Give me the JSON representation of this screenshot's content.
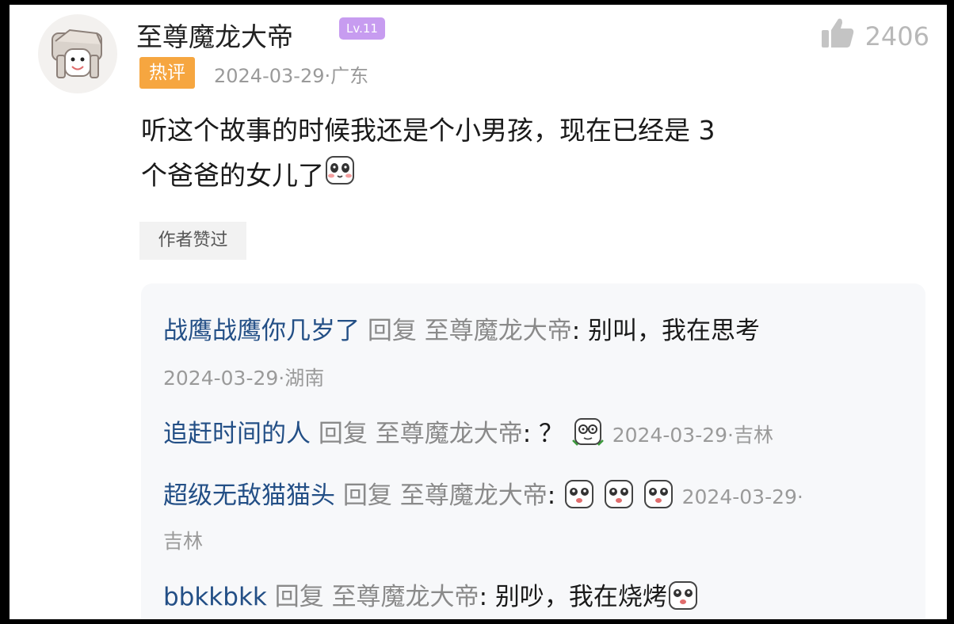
{
  "comment": {
    "username": "至尊魔龙大帝",
    "level_badge": "Lv.11",
    "like_count": "2406",
    "hot_badge": "热评",
    "date_location": "2024-03-29·广东",
    "text_line1": "听这个故事的时候我还是个小男孩，现在已经是 3",
    "text_line2": "个爸爸的女儿了",
    "emoji": "panda-blush-emoji",
    "author_liked": "作者赞过"
  },
  "replies": [
    {
      "nickname": "战鹰战鹰你几岁了",
      "verb": "回复",
      "target": "至尊魔龙大帝",
      "colon": ":",
      "text": "别叫，我在思考",
      "date_location": "2024-03-29·湖南"
    },
    {
      "nickname": "追赶时间的人",
      "verb": "回复",
      "target": "至尊魔龙大帝",
      "colon": ":",
      "text": "？",
      "emoji": "panda-dizzy-emoji",
      "date_location": "2024-03-29·吉林"
    },
    {
      "nickname": "超级无敌猫猫头",
      "verb": "回复",
      "target": "至尊魔龙大帝",
      "colon": ":",
      "emoji": "panda-face-emoji",
      "date_location_part1": "2024-03-29·",
      "date_location_part2": "吉林"
    },
    {
      "nickname": "bbkkbkk",
      "verb": "回复",
      "target": "至尊魔龙大帝",
      "colon": ":",
      "text": "别吵，我在烧烤",
      "emoji": "panda-face-emoji"
    }
  ],
  "colors": {
    "nickname": "#234f86",
    "hot_badge": "#f6a640",
    "level_badge": "#c79cf0",
    "reply_background": "#f7f8fa",
    "meta_text": "#9a9a9a"
  }
}
